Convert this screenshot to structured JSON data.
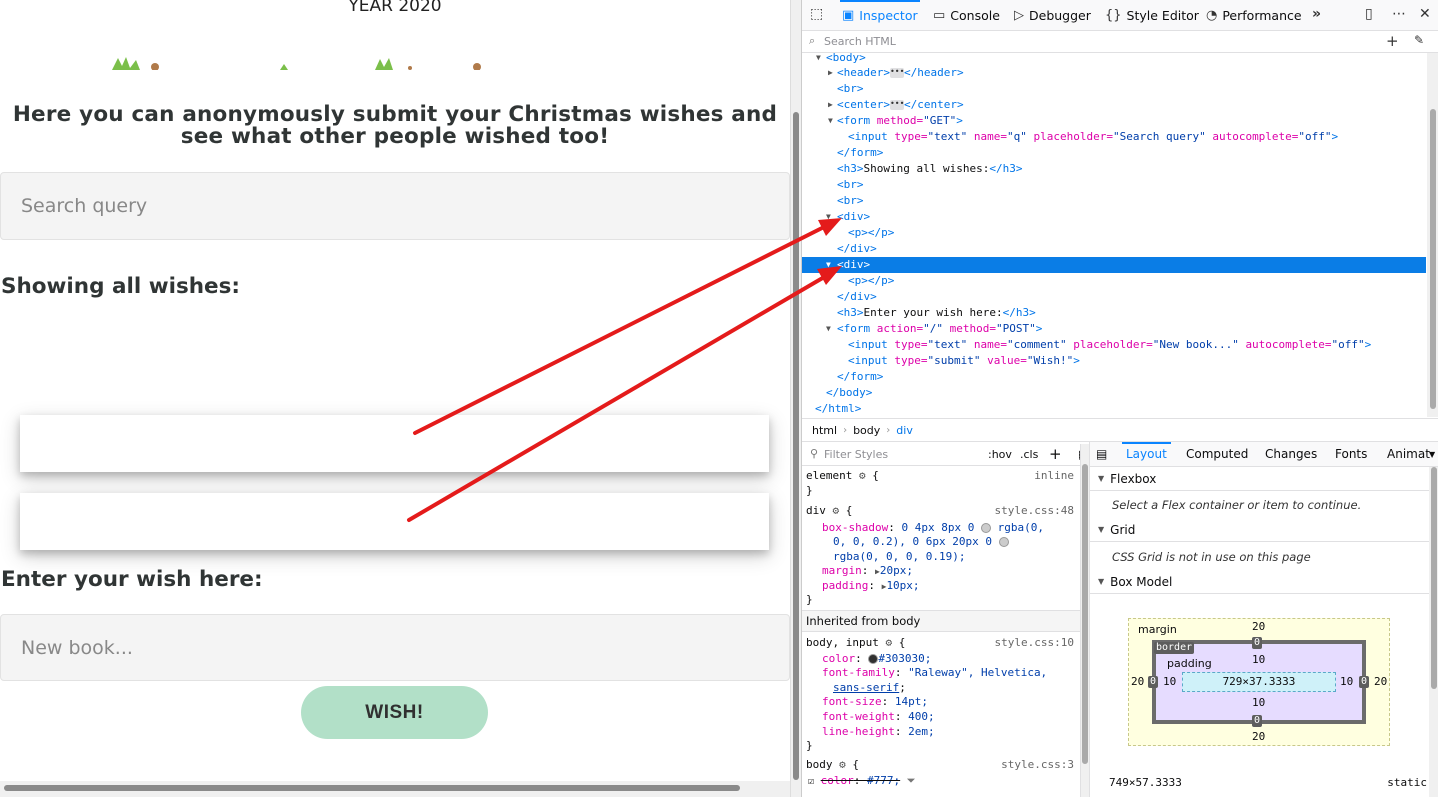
{
  "page": {
    "year_text": "YEAR 2020",
    "intro": "Here you can anonymously submit your Christmas wishes and see what other people wished too!",
    "search_placeholder": "Search query",
    "showing_heading": "Showing all wishes:",
    "enter_heading": "Enter your wish here:",
    "wish_placeholder": "New book...",
    "wish_button": "WISH!"
  },
  "devtools": {
    "tabs": [
      {
        "label": "Inspector",
        "icon": "inspector-icon"
      },
      {
        "label": "Console",
        "icon": "console-icon"
      },
      {
        "label": "Debugger",
        "icon": "debugger-icon"
      },
      {
        "label": "Style Editor",
        "icon": "style-editor-icon"
      },
      {
        "label": "Performance",
        "icon": "performance-icon"
      }
    ],
    "search_html_placeholder": "Search HTML",
    "markup": {
      "body_open": "<body>",
      "header": [
        "<header>",
        "</header>"
      ],
      "br": "<br>",
      "center": [
        "<center>",
        "</center>"
      ],
      "form_get": {
        "tag": "<form",
        "attr": "method=",
        "val": "\"GET\"",
        "close": ">"
      },
      "input_q": {
        "tag": "<input",
        "a1": "type=",
        "v1": "\"text\"",
        "a2": "name=",
        "v2": "\"q\"",
        "a3": "placeholder=",
        "v3": "\"Search query\"",
        "a4": "autocomplete=",
        "v4": "\"off\"",
        "close": ">"
      },
      "form_close": "</form>",
      "h3_showing": {
        "open": "<h3>",
        "text": "Showing all wishes:",
        "close": "</h3>"
      },
      "div_open": "<div>",
      "p_empty": "<p></p>",
      "div_close": "</div>",
      "h3_enter": {
        "open": "<h3>",
        "text": "Enter your wish here:",
        "close": "</h3>"
      },
      "form_post": {
        "tag": "<form",
        "a1": "action=",
        "v1": "\"/\"",
        "a2": "method=",
        "v2": "\"POST\"",
        "close": ">"
      },
      "input_comment": {
        "tag": "<input",
        "a1": "type=",
        "v1": "\"text\"",
        "a2": "name=",
        "v2": "\"comment\"",
        "a3": "placeholder=",
        "v3": "\"New book...\"",
        "a4": "autocomplete=",
        "v4": "\"off\"",
        "close": ">"
      },
      "input_submit": {
        "tag": "<input",
        "a1": "type=",
        "v1": "\"submit\"",
        "a2": "value=",
        "v2": "\"Wish!\"",
        "close": ">"
      },
      "body_close": "</body>",
      "html_close": "</html>"
    },
    "breadcrumbs": [
      "html",
      "body",
      "div"
    ],
    "filter_styles_placeholder": "Filter Styles",
    "rules_buttons": [
      ":hov",
      ".cls"
    ],
    "rules": {
      "element_selector": "element",
      "element_source": "inline",
      "div_selector": "div",
      "div_source": "style.css:48",
      "box_shadow_prop": "box-shadow",
      "box_shadow_val1": "0 4px 8px 0",
      "box_shadow_val2": "rgba(0,",
      "box_shadow_val3": "0, 0, 0.2), 0 6px 20px 0",
      "box_shadow_val4": "rgba(0, 0, 0, 0.19);",
      "margin_prop": "margin",
      "margin_val": "20px;",
      "padding_prop": "padding",
      "padding_val": "10px;",
      "inherited_label": "Inherited from body",
      "body_selector": "body, input",
      "body_source": "style.css:10",
      "color_prop": "color",
      "color_val": "#303030;",
      "font_family_prop": "font-family",
      "font_family_val": "\"Raleway\", Helvetica,",
      "font_family_val2": "sans-serif",
      "font_size_prop": "font-size",
      "font_size_val": "14pt;",
      "font_weight_prop": "font-weight",
      "font_weight_val": "400;",
      "line_height_prop": "line-height",
      "line_height_val": "2em;",
      "body2_selector": "body",
      "body2_source": "style.css:3",
      "color2_prop": "color",
      "color2_val": "#777;"
    },
    "side_tabs": [
      "Layout",
      "Computed",
      "Changes",
      "Fonts",
      "Animat"
    ],
    "sections": {
      "flexbox": "Flexbox",
      "flexbox_note": "Select a Flex container or item to continue.",
      "grid": "Grid",
      "grid_note": "CSS Grid is not in use on this page",
      "box_model": "Box Model"
    },
    "box_model": {
      "margin_label": "margin",
      "border_label": "border",
      "padding_label": "padding",
      "margin_top": "20",
      "margin_bottom": "20",
      "margin_left": "20",
      "margin_right": "20",
      "border_top": "0",
      "border_bottom": "0",
      "border_left": "0",
      "border_right": "0",
      "padding_top": "10",
      "padding_bottom": "10",
      "padding_left": "10",
      "padding_right": "10",
      "content": "729×37.3333",
      "dimensions": "749×57.3333",
      "position": "static"
    }
  },
  "colors": {
    "accent": "#0a84ff",
    "selection": "#0a7de6",
    "wish_button": "#b2e0c8",
    "arrow": "#e41b1b"
  }
}
